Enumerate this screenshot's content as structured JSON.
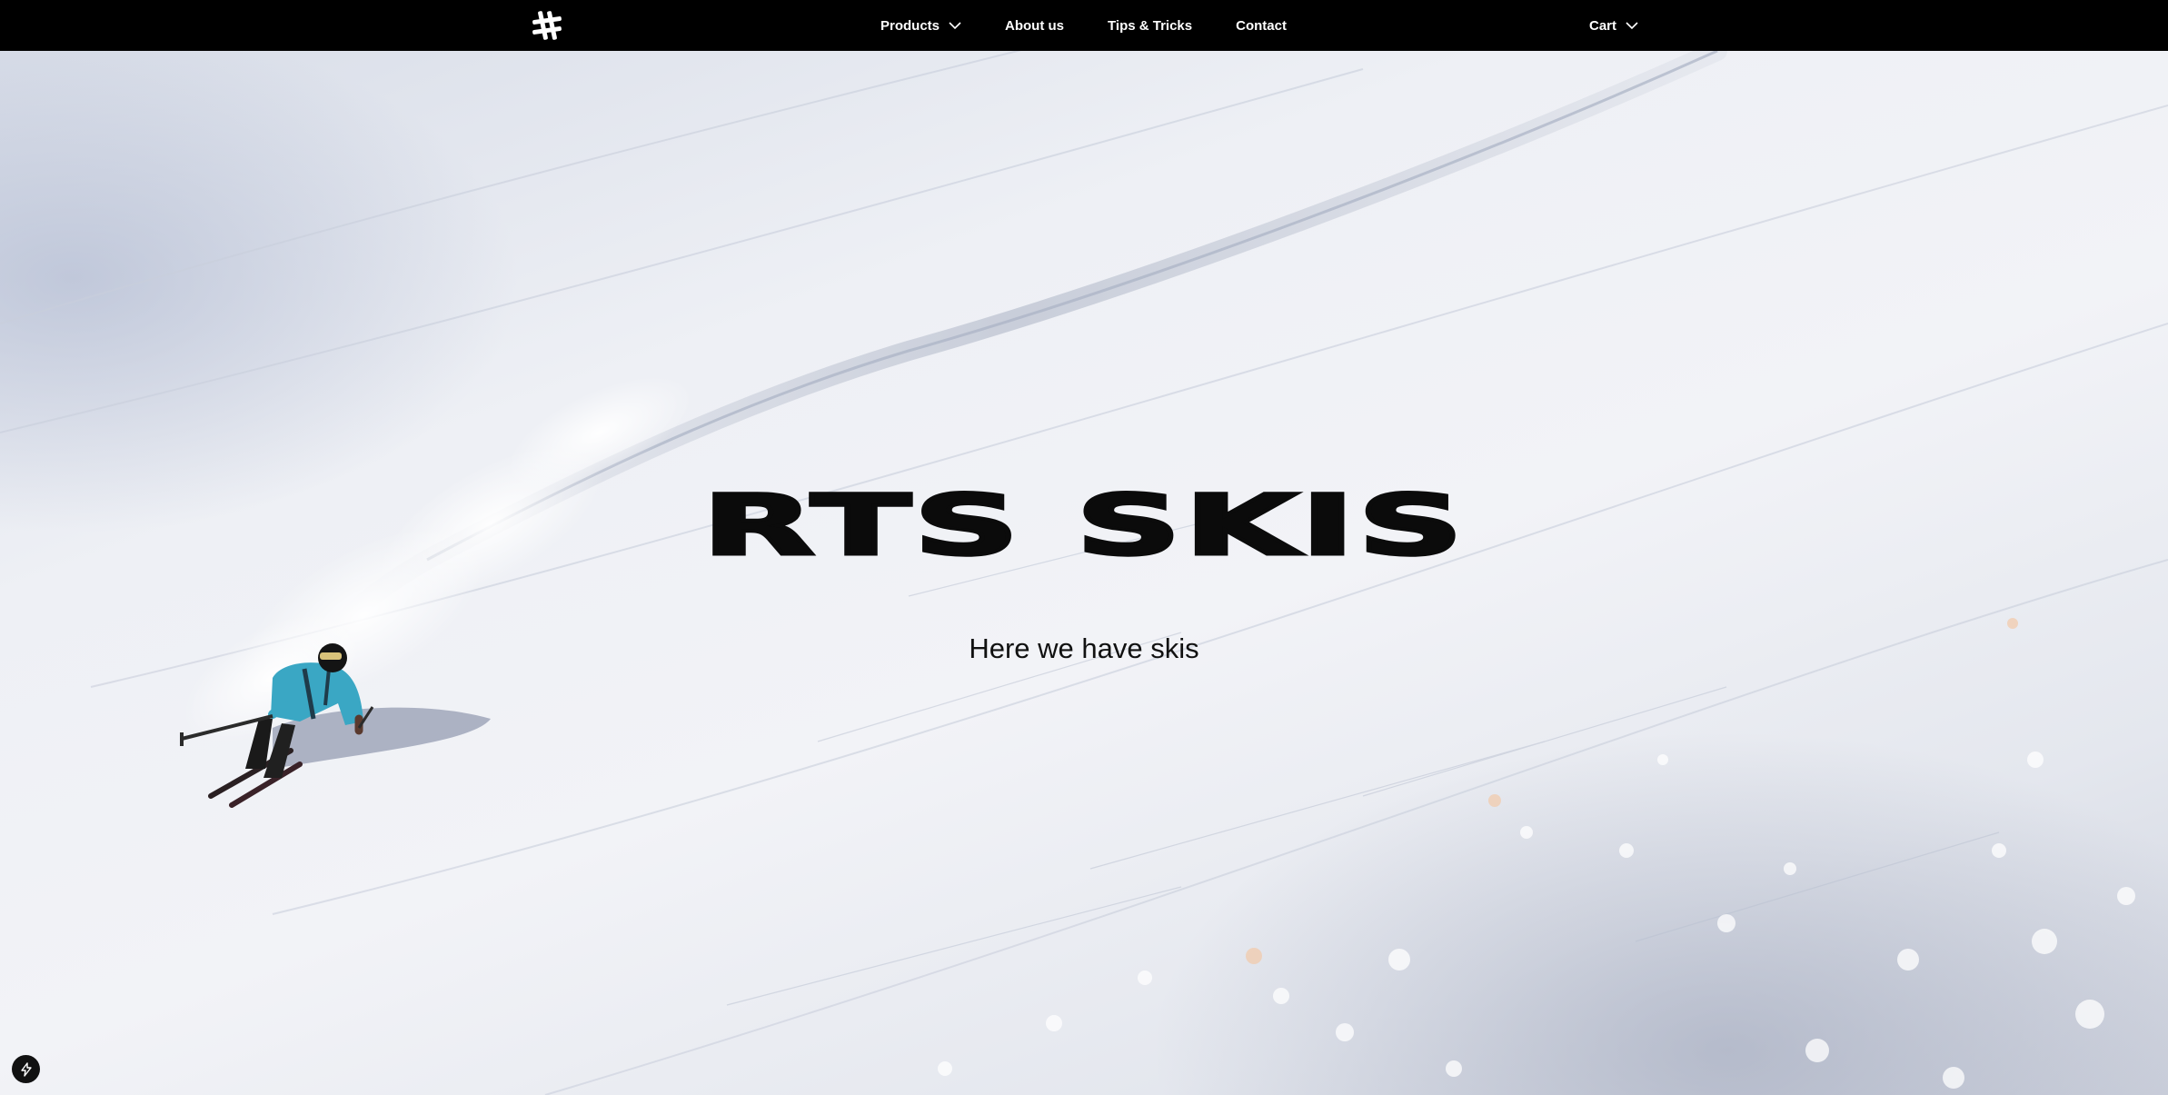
{
  "nav": {
    "logo": "hash-logo",
    "links": [
      {
        "label": "Products",
        "has_dropdown": true
      },
      {
        "label": "About us",
        "has_dropdown": false
      },
      {
        "label": "Tips & Tricks",
        "has_dropdown": false
      },
      {
        "label": "Contact",
        "has_dropdown": false
      }
    ],
    "cart_label": "Cart"
  },
  "hero": {
    "title": "RTS SKIS",
    "subtitle": "Here we have skis",
    "image": "skier-on-snow-slope"
  },
  "colors": {
    "nav_bg": "#000000",
    "nav_text": "#ffffff",
    "title": "#0b0b0b",
    "jacket": "#3aa7c4"
  },
  "icons": {
    "logo": "hash-logo-icon",
    "dropdown": "chevron-down-icon",
    "badge": "lightning-bolt-icon"
  }
}
